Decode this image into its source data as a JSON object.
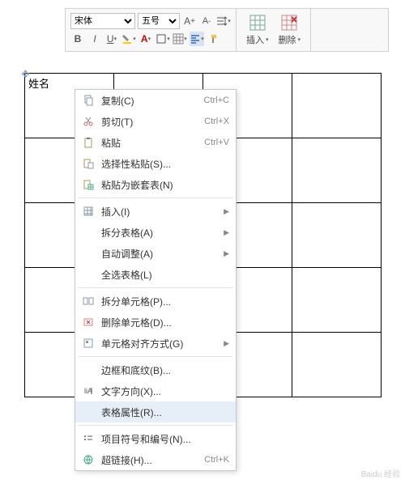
{
  "toolbar": {
    "font_name": "宋体",
    "font_size": "五号",
    "insert_label": "插入",
    "delete_label": "删除"
  },
  "table": {
    "cell_0_0": "姓名"
  },
  "menu": {
    "copy": {
      "label": "复制(C)",
      "shortcut": "Ctrl+C"
    },
    "cut": {
      "label": "剪切(T)",
      "shortcut": "Ctrl+X"
    },
    "paste": {
      "label": "粘贴",
      "shortcut": "Ctrl+V"
    },
    "paste_special": {
      "label": "选择性粘贴(S)..."
    },
    "paste_nested": {
      "label": "粘贴为嵌套表(N)"
    },
    "insert": {
      "label": "插入(I)"
    },
    "split_table": {
      "label": "拆分表格(A)"
    },
    "auto_fit": {
      "label": "自动调整(A)"
    },
    "select_all": {
      "label": "全选表格(L)"
    },
    "split_cells": {
      "label": "拆分单元格(P)..."
    },
    "delete_cells": {
      "label": "删除单元格(D)..."
    },
    "cell_align": {
      "label": "单元格对齐方式(G)"
    },
    "borders": {
      "label": "边框和底纹(B)..."
    },
    "text_direction": {
      "label": "文字方向(X)..."
    },
    "table_props": {
      "label": "表格属性(R)..."
    },
    "bullets": {
      "label": "项目符号和编号(N)..."
    },
    "hyperlink": {
      "label": "超链接(H)...",
      "shortcut": "Ctrl+K"
    }
  },
  "watermark": "Baidu 经验"
}
